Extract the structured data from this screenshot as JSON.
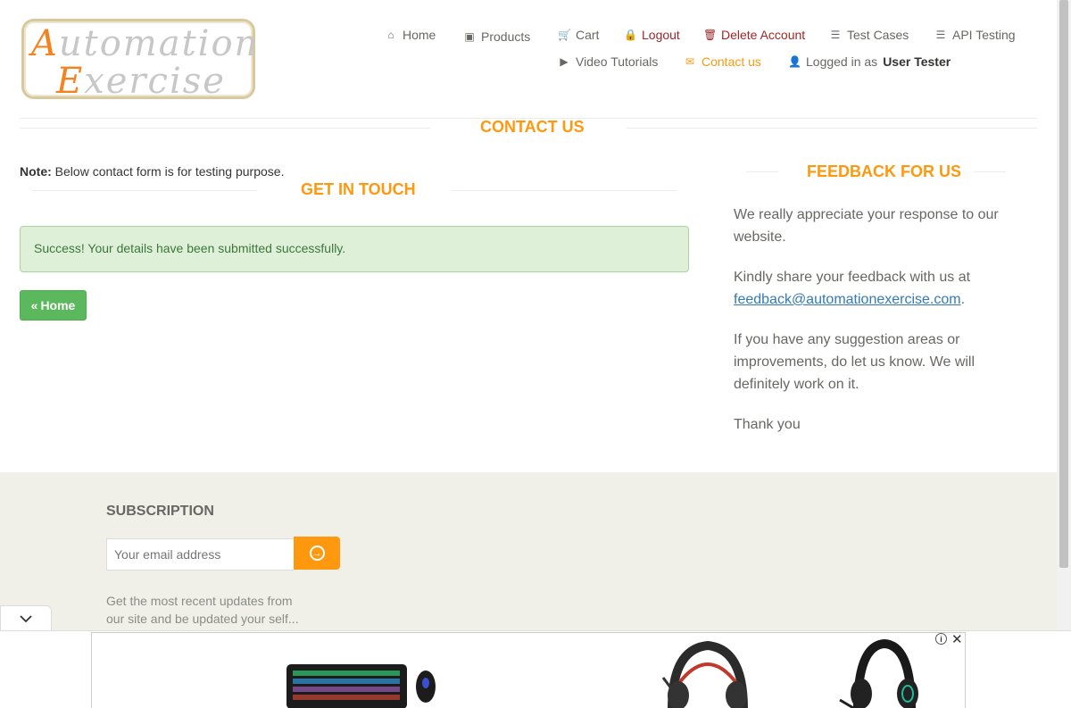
{
  "logo": {
    "line1_cap": "A",
    "line1_rest": "utomation",
    "line2_cap": "E",
    "line2_rest": "xercise"
  },
  "nav": {
    "home": "Home",
    "products": "Products",
    "cart": "Cart",
    "logout": "Logout",
    "delete_account": "Delete Account",
    "test_cases": "Test Cases",
    "api_testing": "API Testing",
    "video_tutorials": "Video Tutorials",
    "contact_us": "Contact us",
    "logged_in_prefix": "Logged in as",
    "logged_in_user": "User Tester"
  },
  "contact": {
    "title": "CONTACT US",
    "note_label": "Note:",
    "note_text": " Below contact form is for testing purpose.",
    "get_in_touch": "GET IN TOUCH",
    "success_message": "Success! Your details have been submitted successfully.",
    "home_button": "Home"
  },
  "feedback": {
    "title": "FEEDBACK FOR US",
    "p1": "We really appreciate your response to our website.",
    "p2_prefix": "Kindly share your feedback with us at",
    "p2_email": "feedback@automationexercise.com",
    "p2_suffix": ".",
    "p3": "If you have any suggestion areas or improvements, do let us know. We will definitely work on it.",
    "p4": "Thank you"
  },
  "footer": {
    "subscription_title": "SUBSCRIPTION",
    "email_placeholder": "Your email address",
    "subscription_text": "Get the most recent updates from our site and be updated your self..."
  },
  "colors": {
    "accent": "#fe980f",
    "success_bg": "#dff0d8",
    "button_green": "#5cb85c",
    "danger": "#a12727"
  }
}
